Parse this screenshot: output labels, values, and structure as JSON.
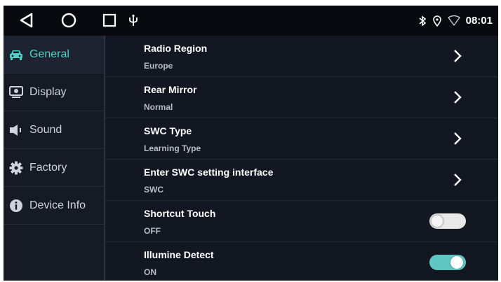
{
  "statusbar": {
    "icons": [
      "back-triangle-icon",
      "home-circle-icon",
      "recents-square-icon",
      "usb-icon",
      "bluetooth-icon",
      "location-icon",
      "wifi-icon"
    ],
    "time": "08:01"
  },
  "sidebar": {
    "items": [
      {
        "label": "General",
        "icon": "car-icon",
        "active": true
      },
      {
        "label": "Display",
        "icon": "monitor-icon",
        "active": false
      },
      {
        "label": "Sound",
        "icon": "speaker-icon",
        "active": false
      },
      {
        "label": "Factory",
        "icon": "gear-icon",
        "active": false
      },
      {
        "label": "Device Info",
        "icon": "info-icon",
        "active": false
      }
    ]
  },
  "settings": {
    "rows": [
      {
        "title": "Radio Region",
        "value": "Europe",
        "control": "chevron"
      },
      {
        "title": "Rear Mirror",
        "value": "Normal",
        "control": "chevron"
      },
      {
        "title": "SWC Type",
        "value": "Learning Type",
        "control": "chevron"
      },
      {
        "title": "Enter SWC setting interface",
        "value": "SWC",
        "control": "chevron"
      },
      {
        "title": "Shortcut Touch",
        "value": "OFF",
        "control": "toggle",
        "toggle_on": false
      },
      {
        "title": "Illumine Detect",
        "value": "ON",
        "control": "toggle",
        "toggle_on": true
      }
    ]
  },
  "colors": {
    "accent": "#4fd1c5",
    "toggle_on": "#5fc6c1",
    "background": "#131722"
  }
}
